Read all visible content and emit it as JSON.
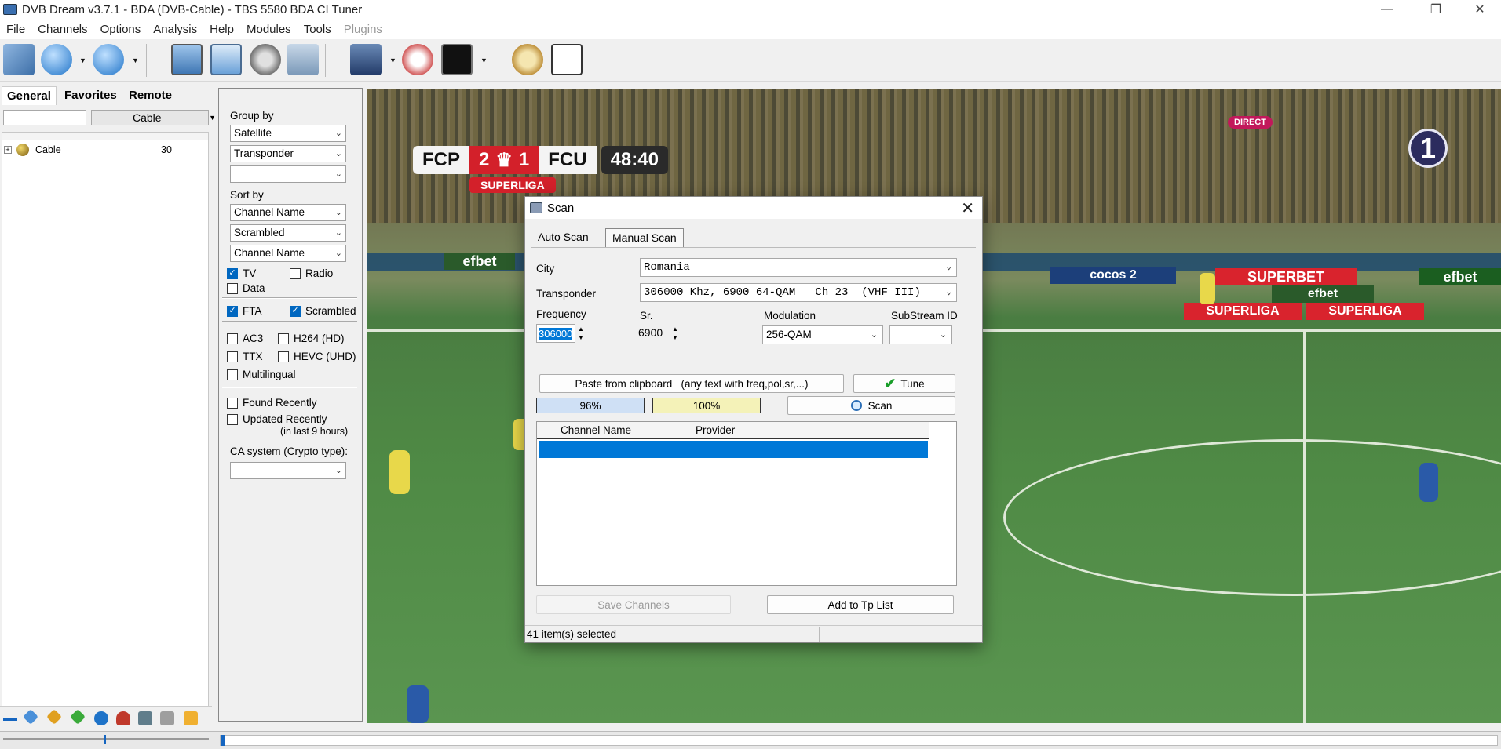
{
  "window": {
    "title": "DVB Dream v3.7.1 - BDA (DVB-Cable)  -  TBS 5580 BDA CI Tuner",
    "min_glyph": "—",
    "restore_glyph": "❐",
    "close_glyph": "✕"
  },
  "menu": {
    "items": [
      "File",
      "Channels",
      "Options",
      "Analysis",
      "Help",
      "Modules",
      "Tools"
    ],
    "disabled_item": "Plugins"
  },
  "left_panel": {
    "tabs": [
      "General",
      "Favorites",
      "Remote"
    ],
    "search_value": "",
    "network_selector": "Cable",
    "tree": {
      "expander": "+",
      "label": "Cable",
      "count": "30"
    }
  },
  "filters": {
    "group_by_label": "Group by",
    "group_by": [
      "Satellite",
      "Transponder",
      ""
    ],
    "sort_by_label": "Sort by",
    "sort_by": [
      "Channel Name",
      "Scrambled",
      "Channel Name"
    ],
    "tv": {
      "label": "TV",
      "checked": true
    },
    "radio": {
      "label": "Radio",
      "checked": false
    },
    "data": {
      "label": "Data",
      "checked": false
    },
    "fta": {
      "label": "FTA",
      "checked": true
    },
    "scrambled": {
      "label": "Scrambled",
      "checked": true
    },
    "ac3": {
      "label": "AC3",
      "checked": false
    },
    "h264": {
      "label": "H264 (HD)",
      "checked": false
    },
    "ttx": {
      "label": "TTX",
      "checked": false
    },
    "hevc": {
      "label": "HEVC (UHD)",
      "checked": false
    },
    "multilingual": {
      "label": "Multilingual",
      "checked": false
    },
    "found_recently": {
      "label": "Found Recently",
      "checked": false
    },
    "updated_recently": {
      "label": "Updated Recently",
      "checked": false
    },
    "last_hours_note": "(in last 9 hours)",
    "ca_system_label": "CA system (Crypto type):",
    "ca_system": ""
  },
  "video": {
    "score_home": "FCP",
    "score_home_goals": "2",
    "score_away_goals": "1",
    "score_away": "FCU",
    "clock": "48:40",
    "league_badge": "SUPERLIGA",
    "live_badge": "DIRECT",
    "channel_number": "1",
    "ads": [
      "efbet",
      "SUPERBET",
      "efbet",
      "SUPERLIGA",
      "SUPERLIGA",
      "cocos 2",
      "efbet"
    ]
  },
  "scan_dialog": {
    "title": "Scan",
    "close_glyph": "✕",
    "tabs": [
      "Auto Scan",
      "Manual Scan"
    ],
    "active_tab": "Manual Scan",
    "city_label": "City",
    "city_value": "Romania",
    "transponder_label": "Transponder",
    "transponder_value": "306000 Khz, 6900 64-QAM   Ch 23  (VHF III)",
    "frequency_label": "Frequency",
    "frequency_value": "306000",
    "sr_label": "Sr.",
    "sr_value": "6900",
    "modulation_label": "Modulation",
    "modulation_value": "256-QAM",
    "substream_label": "SubStream ID",
    "substream_value": "",
    "paste_button": "Paste from clipboard   (any text with freq,pol,sr,...)",
    "tune_button": "Tune",
    "scan_button": "Scan",
    "signal_strength": "96%",
    "signal_quality": "100%",
    "list_headers": [
      "Channel Name",
      "Provider"
    ],
    "save_button": "Save Channels",
    "add_tp_button": "Add to Tp List",
    "status": "41 item(s) selected"
  },
  "colors": {
    "accent": "#0078d7",
    "checkbox": "#0067c0",
    "signal_bar": "#cfe0f5",
    "quality_bar": "#f4f2b8",
    "scoreboard_red": "#d3202a"
  }
}
